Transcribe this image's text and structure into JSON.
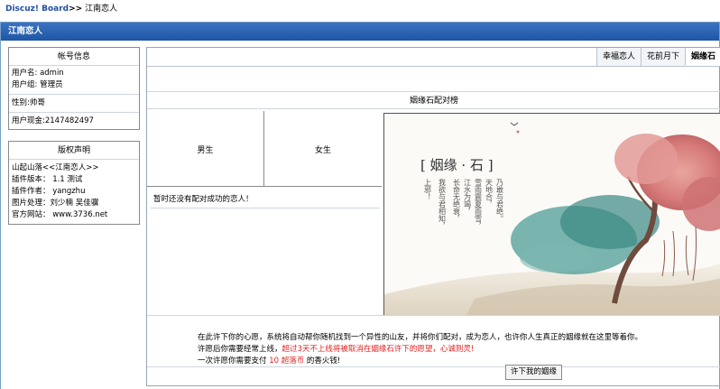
{
  "breadcrumb": {
    "home": "Discuz! Board",
    "separator": ">>",
    "current": "江南恋人"
  },
  "header": {
    "title": "江南恋人"
  },
  "account": {
    "title": "帐号信息",
    "username": "用户名: admin",
    "usergroup": "用户组: 管理员",
    "gender": "性别:帅哥",
    "cash": "用户现金:2147482497"
  },
  "copyright": {
    "title": "版权声明",
    "lines": [
      "山起山落<<江南恋人>>",
      "插件版本： 1.1 测试",
      "插件作者： yangzhu",
      "图片处理：刘少楠 吴佳骥",
      "官方网站： www.3736.net"
    ]
  },
  "tabs": [
    {
      "label": "幸福恋人"
    },
    {
      "label": "花前月下"
    },
    {
      "label": "姻缘石"
    }
  ],
  "section": {
    "title": "姻缘石配对榜"
  },
  "pair": {
    "male": "男生",
    "female": "女生",
    "empty": "暂时还没有配对成功的恋人！"
  },
  "picture": {
    "title": "[ 姻缘 · 石 ]",
    "poem": [
      "乃敢与君绝。",
      "天地合，",
      "雪雨震夏雨雪，",
      "江水为竭，",
      "长命无绝衰，",
      "我欲与君相知，",
      "上邪！"
    ]
  },
  "notice": {
    "line1": "在此许下你的心愿，系统将自动帮你随机找到一个异性的山友，并将你们配对，成为恋人，也许你人生真正的姻缘就在这里等着你。",
    "line2_prefix": "许愿后你需要经常上线，",
    "line2_red": "超过3天不上线将被取消在姻缘石许下的愿望，心诚则灵!",
    "line3_prefix": "一次许愿你需要支付 ",
    "line3_red": "10 超落币",
    "line3_suffix": " 的香火钱!"
  },
  "actions": {
    "submit_label": "许下我的姻缘"
  },
  "colors": {
    "titlebar": "#1e56a6",
    "link": "#1f4f9f",
    "highlight": "#e02020"
  }
}
